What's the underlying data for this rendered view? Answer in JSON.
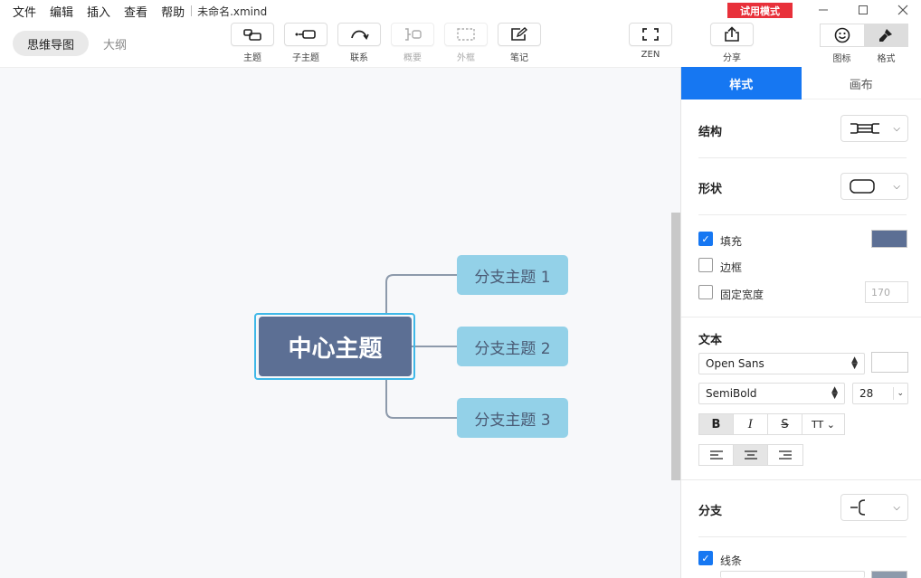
{
  "menu": [
    "文件",
    "编辑",
    "插入",
    "查看",
    "帮助"
  ],
  "filename": "未命名.xmind",
  "trial_badge": "试用模式",
  "view_toggle": {
    "mindmap": "思维导图",
    "outline": "大纲"
  },
  "toolbar": {
    "topic": "主题",
    "subtopic": "子主题",
    "relationship": "联系",
    "summary": "概要",
    "boundary": "外框",
    "note": "笔记",
    "zen": "ZEN",
    "share": "分享",
    "icons": "图标",
    "format": "格式"
  },
  "canvas": {
    "central_topic": "中心主题",
    "branches": [
      "分支主题 1",
      "分支主题 2",
      "分支主题 3"
    ]
  },
  "panel": {
    "tabs": {
      "style": "样式",
      "canvas": "画布"
    },
    "structure_label": "结构",
    "shape_label": "形状",
    "fill_label": "填充",
    "fill_color": "#5c6f94",
    "border_label": "边框",
    "fixed_width_label": "固定宽度",
    "fixed_width_value": "170",
    "text_label": "文本",
    "font_family": "Open Sans",
    "font_weight": "SemiBold",
    "font_size": "28",
    "branch_label": "分支",
    "line_label": "线条"
  },
  "colors": {
    "accent": "#1677f2",
    "central": "#5c6f94",
    "branch": "#93d1e8",
    "trial": "#e8303a"
  }
}
